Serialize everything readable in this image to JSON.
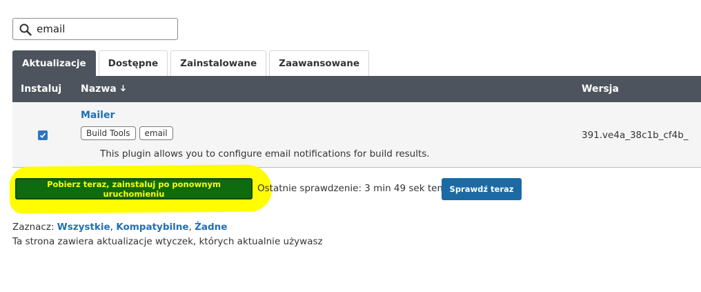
{
  "search": {
    "value": "email",
    "icon": "search-icon"
  },
  "tabs": [
    {
      "label": "Aktualizacje",
      "active": true
    },
    {
      "label": "Dostępne",
      "active": false
    },
    {
      "label": "Zainstalowane",
      "active": false
    },
    {
      "label": "Zaawansowane",
      "active": false
    }
  ],
  "table": {
    "headers": {
      "install": "Instaluj",
      "name": "Nazwa",
      "name_sort_icon": "arrow-down-icon",
      "version": "Wersja"
    },
    "rows": [
      {
        "checked": true,
        "name": "Mailer",
        "labels": [
          "Build Tools",
          "email"
        ],
        "description": "This plugin allows you to configure email notifications for build results.",
        "version": "391.ve4a_38c1b_cf4b_"
      }
    ]
  },
  "actions": {
    "download_label": "Pobierz teraz, zainstaluj po ponownym uruchomieniu",
    "last_check": "Ostatnie sprawdzenie: 3 min 49 sek temu",
    "check_now_label": "Sprawdź teraz"
  },
  "select": {
    "prefix": "Zaznacz: ",
    "all": "Wszystkie",
    "sep1": ", ",
    "compatible": "Kompatybilne",
    "sep2": ", ",
    "none": "Żadne"
  },
  "footer_note": "Ta strona zawiera aktualizacje wtyczek, których aktualnie używasz",
  "colors": {
    "header_bg": "#4d545d",
    "link": "#1f6fb5",
    "download_button": "#0f6b0f",
    "download_text": "#fffd00",
    "highlight": "#fffd00",
    "check_now_button": "#1b6aa3",
    "checkbox": "#2d74c4"
  }
}
